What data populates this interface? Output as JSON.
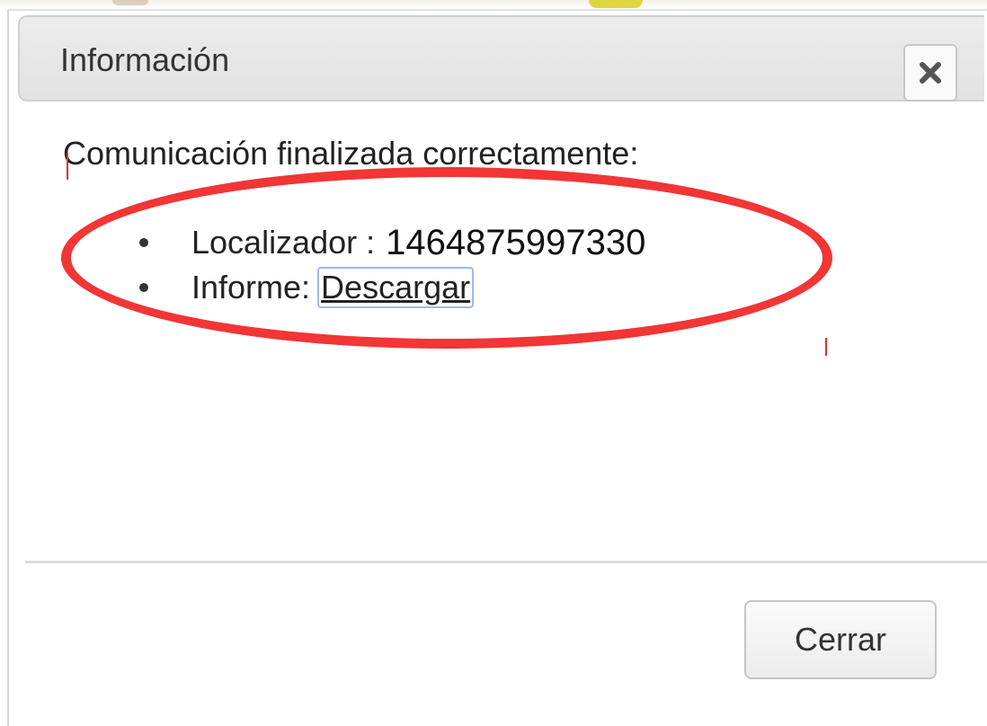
{
  "dialog": {
    "title": "Información",
    "close_icon": "close-x-icon",
    "message": "Comunicación finalizada correctamente:",
    "details": {
      "locator_label": "Localizador :",
      "locator_value": "1464875997330",
      "report_label": "Informe:",
      "report_link": "Descargar"
    },
    "footer": {
      "close_label": "Cerrar"
    }
  },
  "colors": {
    "highlight": "#f23535",
    "titlebar": "#e6e6e6",
    "link_focus": "#9dbbe8"
  }
}
